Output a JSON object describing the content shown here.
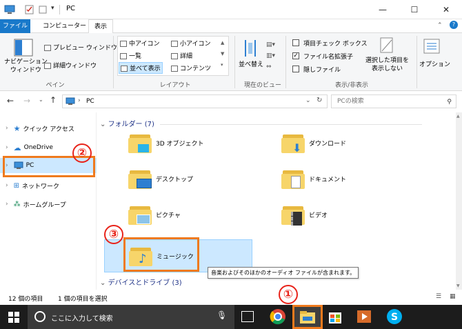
{
  "window": {
    "title": "PC"
  },
  "tabs": [
    "ファイル",
    "コンピューター",
    "表示"
  ],
  "ribbon": {
    "pane": {
      "nav_pane_label": "ナビゲーション\nウィンドウ",
      "preview": "プレビュー ウィンドウ",
      "details": "詳細ウィンドウ",
      "group": "ペイン"
    },
    "layout": {
      "items": [
        "中アイコン",
        "小アイコン",
        "一覧",
        "詳細",
        "並べて表示",
        "コンテンツ"
      ],
      "group": "レイアウト"
    },
    "current_view": {
      "sort": "並べ替え",
      "group": "現在のビュー"
    },
    "show_hide": {
      "item_checkbox": "項目チェック ボックス",
      "file_ext": "ファイル名拡張子",
      "hidden": "隠しファイル",
      "hide_selected": "選択した項目を\n表示しない",
      "group": "表示/非表示"
    },
    "options": "オプション"
  },
  "address": {
    "path": "PC",
    "search_placeholder": "PCの検索"
  },
  "nav": {
    "items": [
      "クイック アクセス",
      "OneDrive",
      "PC",
      "ネットワーク",
      "ホームグループ"
    ]
  },
  "content": {
    "folders_header": "フォルダー (7)",
    "folders": [
      "3D オブジェクト",
      "ダウンロード",
      "デスクトップ",
      "ドキュメント",
      "ピクチャ",
      "ビデオ",
      "ミュージック"
    ],
    "drives_header": "デバイスとドライブ (3)",
    "tooltip": "音楽およびそのほかのオーディオ ファイルが含まれます。"
  },
  "status": {
    "count": "12 個の項目",
    "selected": "1 個の項目を選択"
  },
  "taskbar": {
    "search": "ここに入力して検索"
  },
  "callouts": [
    "①",
    "②",
    "③"
  ],
  "colors": {
    "accent": "#1979ca",
    "callout_red": "#e8231a",
    "callout_orange": "#ef7a1d",
    "selection": "#cce8ff"
  }
}
